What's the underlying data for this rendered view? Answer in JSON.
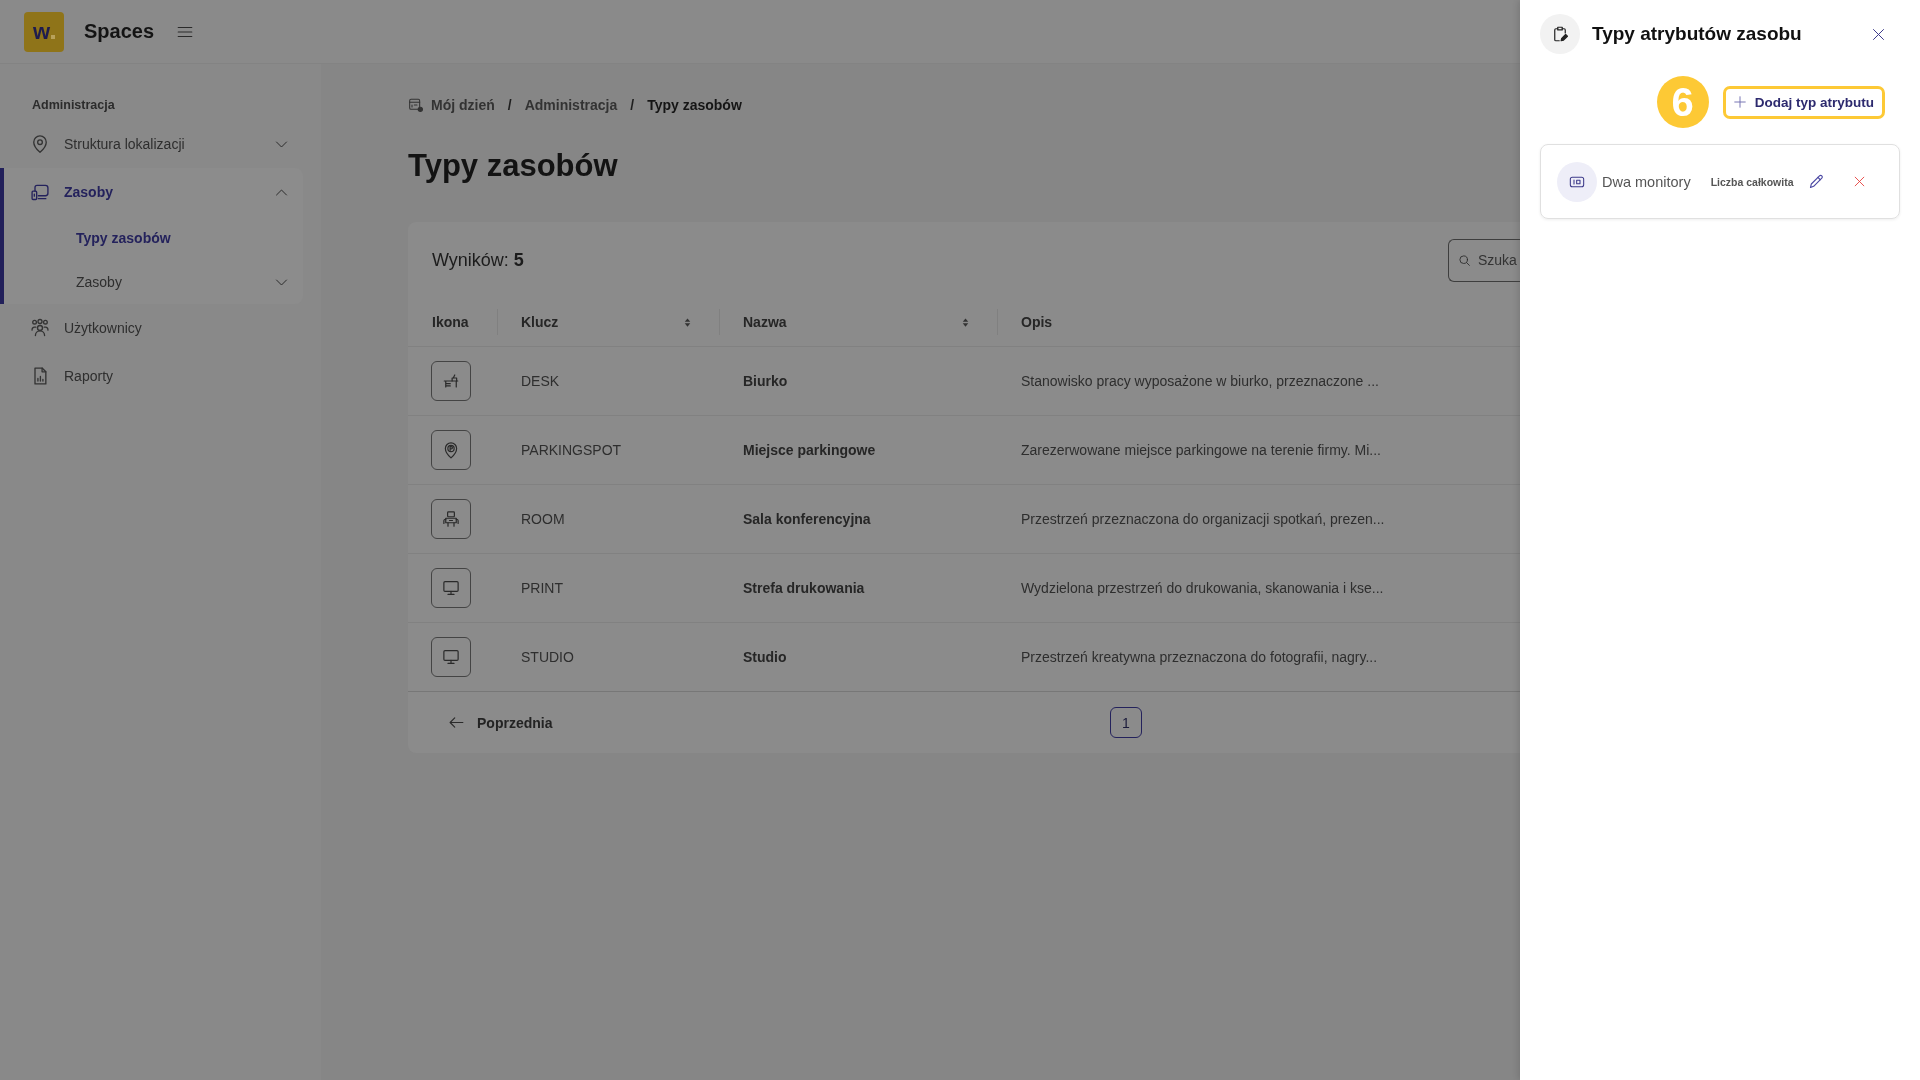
{
  "header": {
    "logo": "w",
    "app_name": "Spaces"
  },
  "sidebar": {
    "section": "Administracja",
    "items": [
      {
        "label": "Struktura lokalizacji",
        "kind": "group",
        "expanded": false,
        "selected": false
      },
      {
        "label": "Zasoby",
        "kind": "group",
        "expanded": true,
        "selected": true,
        "children": [
          {
            "label": "Typy zasobów",
            "kind": "link",
            "selected": true
          },
          {
            "label": "Zasoby",
            "kind": "group",
            "expanded": false,
            "selected": false
          }
        ]
      },
      {
        "label": "Użytkownicy",
        "kind": "link",
        "selected": false
      },
      {
        "label": "Raporty",
        "kind": "link",
        "selected": false
      }
    ]
  },
  "breadcrumbs": [
    {
      "label": "Mój dzień",
      "current": false
    },
    {
      "label": "Administracja",
      "separator": "/",
      "current": false
    },
    {
      "label": "Typy zasobów",
      "separator": "/",
      "current": true
    }
  ],
  "page": {
    "title": "Typy zasobów"
  },
  "table": {
    "results": "Wyników: **5**",
    "search": {
      "placeholder": "Szuka"
    },
    "columns": [
      {
        "label": "Ikona",
        "sortable": false
      },
      {
        "label": "Klucz",
        "sortable": true
      },
      {
        "label": "Nazwa",
        "sortable": true
      },
      {
        "label": "Opis",
        "sortable": false
      }
    ],
    "rows": [
      {
        "kind": "desk",
        "key": "DESK",
        "name": "Biurko",
        "description": "Stanowisko pracy wyposażone w biurko, przeznaczone ..."
      },
      {
        "kind": "parking",
        "key": "PARKINGSPOT",
        "name": "Miejsce parkingowe",
        "description": "Zarezerwowane miejsce parkingowe na terenie firmy. Mi..."
      },
      {
        "kind": "room",
        "key": "ROOM",
        "name": "Sala konferencyjna",
        "description": "Przestrzeń przeznaczona do organizacji spotkań, prezen..."
      },
      {
        "kind": "monitor",
        "key": "PRINT",
        "name": "Strefa drukowania",
        "description": "Wydzielona przestrzeń do drukowania, skanowania i kse..."
      },
      {
        "kind": "monitor",
        "key": "STUDIO",
        "name": "Studio",
        "description": "Przestrzeń kreatywna przeznaczona do fotografii, nagry..."
      }
    ]
  },
  "pagination": {
    "previous": "Poprzednia",
    "pages": [
      {
        "label": "1",
        "selected": true
      }
    ]
  },
  "panel": {
    "title": "Typy atrybutów zasobu",
    "step_badge": "6",
    "add_button": "Dodaj typ atrybutu",
    "attributes": [
      {
        "name": "Dwa monitory",
        "type": "Liczba całkowita"
      }
    ]
  }
}
